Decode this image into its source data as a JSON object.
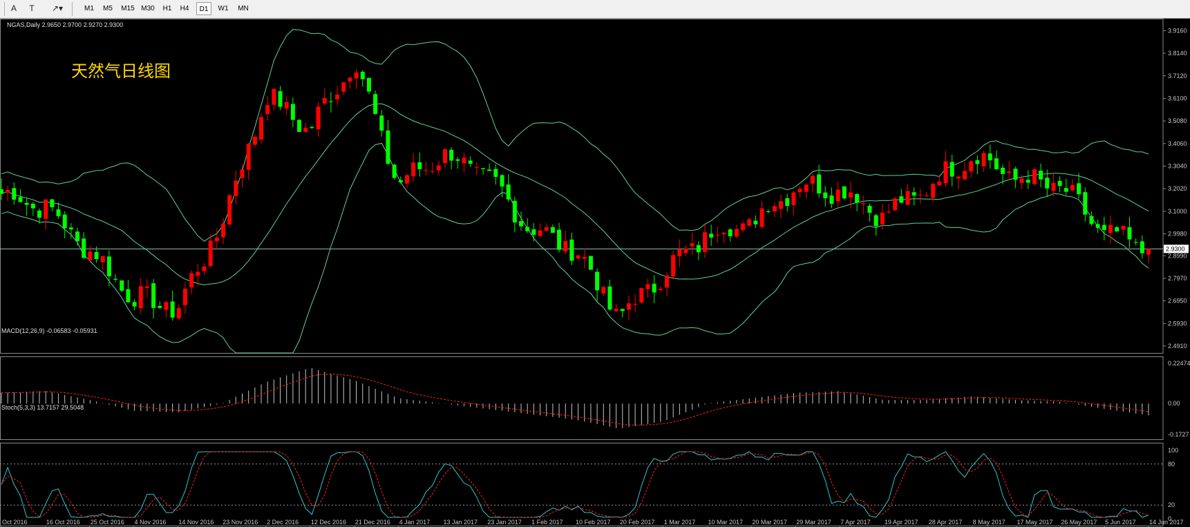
{
  "toolbar": {
    "tools": [
      {
        "name": "text-tool-icon",
        "glyph": "A"
      },
      {
        "name": "text-label-tool-icon",
        "glyph": "T"
      },
      {
        "name": "arrow-tool-icon",
        "glyph": "↗▾"
      }
    ],
    "timeframes": [
      "M1",
      "M5",
      "M15",
      "M30",
      "H1",
      "H4",
      "D1",
      "W1",
      "MN"
    ],
    "active_timeframe": "D1"
  },
  "chart_data": [
    {
      "type": "candlestick",
      "info_label": "NGAS,Daily  2.9650 2.9700 2.9270 2.9300",
      "annotation": "天然气日线图",
      "current_price": 2.93,
      "current_price_label": "2.9300",
      "ylim": [
        2.491,
        3.936
      ],
      "yticks": [
        "3.9160",
        "3.8140",
        "3.7120",
        "3.6100",
        "3.5080",
        "3.4060",
        "3.3040",
        "3.2020",
        "3.1000",
        "2.9980",
        "2.8990",
        "2.7970",
        "2.6950",
        "2.5930",
        "2.4910"
      ],
      "overlays": [
        "Bollinger Bands (upper, middle, lower)"
      ],
      "close_path_approx": [
        [
          "Oct 2016",
          3.18
        ],
        [
          "16 Oct 2016",
          3.12
        ],
        [
          "25 Oct 2016",
          2.92
        ],
        [
          "4 Nov 2016",
          2.71
        ],
        [
          "14 Nov 2016",
          2.66
        ],
        [
          "23 Nov 2016",
          3.05
        ],
        [
          "2 Dec 2016",
          3.62
        ],
        [
          "12 Dec 2016",
          3.47
        ],
        [
          "21 Dec 2016",
          3.79
        ],
        [
          "4 Jan 2017",
          3.22
        ],
        [
          "13 Jan 2017",
          3.36
        ],
        [
          "23 Jan 2017",
          3.26
        ],
        [
          "1 Feb 2017",
          3.02
        ],
        [
          "10 Feb 2017",
          2.93
        ],
        [
          "20 Feb 2017",
          2.62
        ],
        [
          "1 Mar 2017",
          2.82
        ],
        [
          "10 Mar 2017",
          3.0
        ],
        [
          "20 Mar 2017",
          3.05
        ],
        [
          "29 Mar 2017",
          3.22
        ],
        [
          "7 Apr 2017",
          3.2
        ],
        [
          "19 Apr 2017",
          3.08
        ],
        [
          "28 Apr 2017",
          3.21
        ],
        [
          "8 May 2017",
          3.36
        ],
        [
          "17 May 2017",
          3.25
        ],
        [
          "26 May 2017",
          3.21
        ],
        [
          "5 Jun 2017",
          3.0
        ],
        [
          "14 Jun 2017",
          2.93
        ]
      ]
    },
    {
      "type": "histogram",
      "info_label": "MACD(12,26,9) -0.06583 -0.05931",
      "ylim": [
        -0.1727,
        0.22474
      ],
      "yticks": [
        "0.22474",
        "0.00",
        "-0.1727"
      ],
      "macd_approx": [
        [
          "Oct 2016",
          0.06
        ],
        [
          "16 Oct 2016",
          0.07
        ],
        [
          "25 Oct 2016",
          0.02
        ],
        [
          "4 Nov 2016",
          -0.04
        ],
        [
          "14 Nov 2016",
          -0.05
        ],
        [
          "23 Nov 2016",
          0.0
        ],
        [
          "2 Dec 2016",
          0.12
        ],
        [
          "12 Dec 2016",
          0.2
        ],
        [
          "21 Dec 2016",
          0.13
        ],
        [
          "4 Jan 2017",
          0.03
        ],
        [
          "13 Jan 2017",
          0.0
        ],
        [
          "23 Jan 2017",
          -0.03
        ],
        [
          "1 Feb 2017",
          -0.06
        ],
        [
          "10 Feb 2017",
          -0.09
        ],
        [
          "20 Feb 2017",
          -0.14
        ],
        [
          "1 Mar 2017",
          -0.1
        ],
        [
          "10 Mar 2017",
          0.0
        ],
        [
          "20 Mar 2017",
          0.03
        ],
        [
          "29 Mar 2017",
          0.06
        ],
        [
          "7 Apr 2017",
          0.07
        ],
        [
          "19 Apr 2017",
          0.02
        ],
        [
          "28 Apr 2017",
          0.02
        ],
        [
          "8 May 2017",
          0.04
        ],
        [
          "17 May 2017",
          0.02
        ],
        [
          "26 May 2017",
          0.01
        ],
        [
          "5 Jun 2017",
          -0.03
        ],
        [
          "14 Jun 2017",
          -0.066
        ]
      ]
    },
    {
      "type": "line",
      "info_label": "Stoch(5,3,3) 13.7157 29.5048",
      "ylim": [
        0,
        100
      ],
      "yticks": [
        "100",
        "80",
        "20",
        "0"
      ],
      "levels": [
        80,
        20
      ]
    }
  ],
  "x_axis_labels": [
    "Oct 2016",
    "16 Oct 2016",
    "25 Oct 2016",
    "4 Nov 2016",
    "14 Nov 2016",
    "23 Nov 2016",
    "2 Dec 2016",
    "12 Dec 2016",
    "21 Dec 2016",
    "4 Jan 2017",
    "13 Jan 2017",
    "23 Jan 2017",
    "1 Feb 2017",
    "10 Feb 2017",
    "20 Feb 2017",
    "1 Mar 2017",
    "10 Mar 2017",
    "20 Mar 2017",
    "29 Mar 2017",
    "7 Apr 2017",
    "19 Apr 2017",
    "28 Apr 2017",
    "8 May 2017",
    "17 May 2017",
    "26 May 2017",
    "5 Jun 2017",
    "14 Jun 2017"
  ],
  "colors": {
    "background": "#000000",
    "bull_candle": "#ff0000",
    "bear_candle": "#00ff00",
    "bands": "#5fd39a",
    "price_line": "#8fc4b8",
    "annotation": "#ffd700",
    "macd_hist": "#c8c8c8",
    "macd_signal": "#ff2020",
    "stoch_main": "#30c8d0",
    "stoch_signal": "#ff2020",
    "axis_text": "#c8c8c8",
    "frame": "#8a8a8a"
  }
}
